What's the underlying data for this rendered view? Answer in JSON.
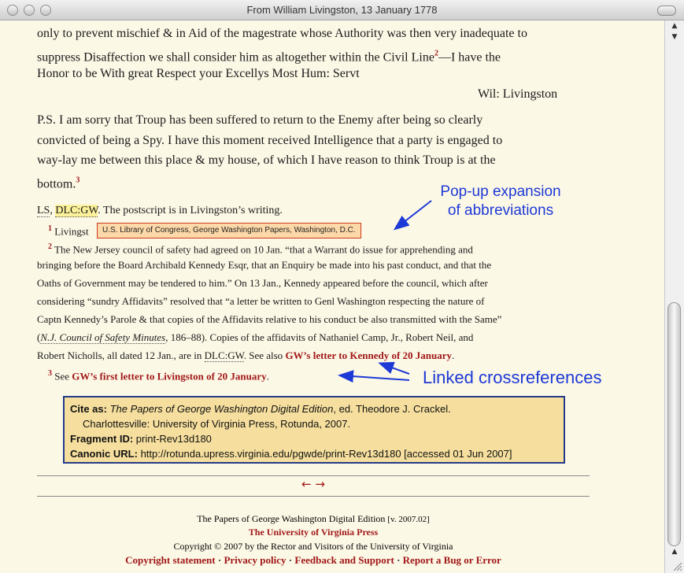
{
  "window": {
    "title": "From William Livingston, 13 January 1778"
  },
  "letter": {
    "line1": "only to prevent mischief & in Aid of the magestrate whose Authority was then very inadequate to",
    "line2_a": "suppress Disaffection we shall consider him as altogether within the Civil Line",
    "line2_sup": "2",
    "line2_b": "—I have the",
    "line3": "Honor to be With great Respect your Excellys Most Hum: Servt",
    "signature": "Wil: Livingston",
    "ps1": "P.S. I am sorry that Troup has been suffered to return to the Enemy after being so clearly",
    "ps2": "convicted of being a Spy. I have this moment received Intelligence that a party is engaged to",
    "ps3": "way-lay me between this place & my house, of which I have reason to think Troup is at the",
    "ps4": "bottom.",
    "ps4_sup": "3"
  },
  "source": {
    "ls": "LS",
    "sep": ", ",
    "dlc": "DLC:GW",
    "rest": ". The postscript is in Livingston’s writing."
  },
  "notes": {
    "n1_num": "1",
    "n1_text": "Livingst",
    "tooltip": "U.S. Library of Congress, George Washington Papers, Washington, D.C.",
    "n2_num": "2",
    "n2_l1": "The New Jersey council of safety had agreed on 10 Jan. “that a Warrant do issue for apprehending and",
    "n2_l2": "bringing before the Board Archibald Kennedy Esqr, that an Enquiry be made into his past conduct, and that the",
    "n2_l3": "Oaths of Government may be tendered to him.” On 13 Jan., Kennedy appeared before the council, which after",
    "n2_l4": "considering “sundry Affidavits” resolved that “a letter be written to Genl Washington respecting the nature of",
    "n2_l5": "Captn Kennedy’s Parole & that copies of the Affidavits relative to his conduct be also transmitted with the Same”",
    "n2_l6_open": "(",
    "n2_l6_title": "N.J. Council of Safety Minutes",
    "n2_l6_rest": ", 186–88). Copies of the affidavits of Nathaniel Camp, Jr., Robert Neil, and",
    "n2_l7_a": "Robert Nicholls, all dated 12 Jan., are in ",
    "n2_l7_dlc": "DLC:GW",
    "n2_l7_b": ". See also ",
    "n2_l7_link": "GW’s letter to Kennedy of 20 January",
    "n2_l7_end": ".",
    "n3_num": "3",
    "n3_see": "See ",
    "n3_link": "GW’s first letter to Livingston of 20 January",
    "n3_end": "."
  },
  "annotations": {
    "popup_line1": "Pop-up expansion",
    "popup_line2": "of abbreviations",
    "linked": "Linked crossreferences"
  },
  "cite": {
    "label1": "Cite as:",
    "title": "The Papers of George Washington Digital Edition",
    "rest1": ", ed. Theodore J. Crackel.",
    "line2": "Charlottesville: University of Virginia Press, Rotunda, 2007.",
    "label3": "Fragment ID:",
    "value3": "print-Rev13d180",
    "label4": "Canonic URL:",
    "value4": "http://rotunda.upress.virginia.edu/pgwde/print-Rev13d180 [accessed 01 Jun 2007]"
  },
  "nav": {
    "prev": "←",
    "next": "→"
  },
  "footer": {
    "edition": "The Papers of George Washington Digital Edition",
    "version": "[v. 2007.02]",
    "press": "The University of Virginia Press",
    "copyright": "Copyright © 2007 by the Rector and Visitors of the University of Virginia",
    "links": [
      "Copyright statement",
      "Privacy policy",
      "Feedback and Support",
      "Report a Bug or Error"
    ],
    "sep": " · "
  },
  "colors": {
    "background": "#fcf8e6",
    "link": "#a01818",
    "annotation": "#1d39d6",
    "cite_bg": "#f6df9e",
    "cite_border": "#233a8a"
  }
}
